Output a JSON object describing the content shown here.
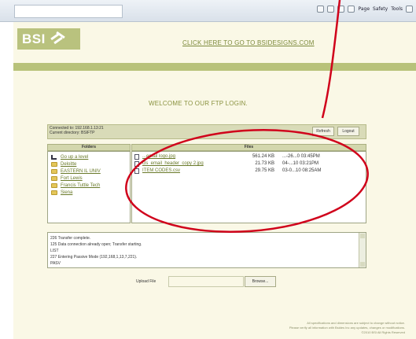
{
  "browser": {
    "toolbar_items": [
      "Page",
      "Safety",
      "Tools"
    ]
  },
  "header": {
    "logo_text": "BSI",
    "cta_text": "CLICK HERE TO GO TO BSIDESIGNS.COM"
  },
  "welcome": "WELCOME TO OUR FTP LOGIN.",
  "connection": {
    "connected_to": "Connected to: 192.168.1.13:21",
    "current_directory": "Current directory: BSIFTP",
    "refresh_label": "Refresh",
    "logout_label": "Logout"
  },
  "folders": {
    "header": "Folders",
    "items": [
      {
        "label": "Go up a level",
        "icon": "up-arrow-icon"
      },
      {
        "label": "Deloitte",
        "icon": "folder-icon"
      },
      {
        "label": "EASTERN IL UNIV",
        "icon": "folder-icon"
      },
      {
        "label": "Fort Lewis",
        "icon": "folder-icon"
      },
      {
        "label": "Francis Tuttle Tech",
        "icon": "folder-icon"
      },
      {
        "label": "Siena",
        "icon": "folder-icon"
      }
    ]
  },
  "files": {
    "header": "Files",
    "rows": [
      {
        "name": "...email logo.jpg",
        "size": "561.24 KB",
        "date": "...-26...0 03:45PM"
      },
      {
        "name": "cls_email_header_copy 2.jpg",
        "size": "21.73 KB",
        "date": "04-...10 03:21PM"
      },
      {
        "name": "ITEM CODES.csv",
        "size": "29.75 KB",
        "date": "03-0...10 08:25AM"
      }
    ]
  },
  "log": {
    "lines": [
      "226 Transfer complete.",
      "125 Data connection already open; Transfer starting.",
      "LIST",
      "227 Entering Passive Mode (192,168,1,13,7,221).",
      "PASV"
    ]
  },
  "upload": {
    "label": "Upload File",
    "value": "",
    "browse_label": "Browse..."
  },
  "footer": {
    "line1": "All specifications and dimensions are subject to change without notice.",
    "line2": "Please verify all information with Bsides Inc any updates, changes or modifications.",
    "line3": "©2010 BSI All Rights Reserved"
  },
  "colors": {
    "accent": "#b8c27a",
    "link": "#6a7a2a",
    "annotation": "#d0021b"
  }
}
